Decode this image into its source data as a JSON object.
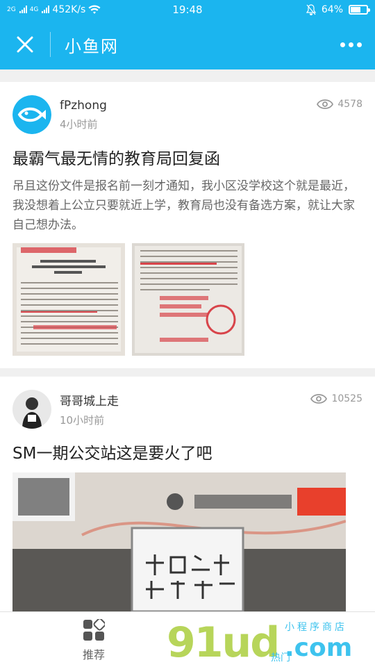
{
  "status_bar": {
    "signal_left": "2G",
    "signal_right": "4G",
    "speed": "452K/s",
    "time": "19:48",
    "battery": "64%",
    "battery_level": 0.64
  },
  "header": {
    "title": "小鱼网",
    "close_icon": "close-icon",
    "more_icon": "more-dots-icon"
  },
  "posts": [
    {
      "author": "fPzhong",
      "time": "4小时前",
      "views": "4578",
      "title": "最霸气最无情的教育局回复函",
      "desc": "吊且这份文件是报名前一刻才通知，我小区没学校这个就是最近，我没想着上公立只要就近上学，教育局也没有备选方案，就让大家自己想办法。"
    },
    {
      "author": "哥哥城上走",
      "time": "10小时前",
      "views": "10525",
      "title": "SM一期公交站这是要火了吧"
    }
  ],
  "bottom_bar": {
    "tab_label": "推荐"
  },
  "watermark": {
    "main": "91ud",
    "com": ".com",
    "sub": "小程序商店",
    "small": "热门"
  },
  "colors": {
    "primary": "#1bb5ef",
    "watermark_green": "#b7d55a"
  }
}
